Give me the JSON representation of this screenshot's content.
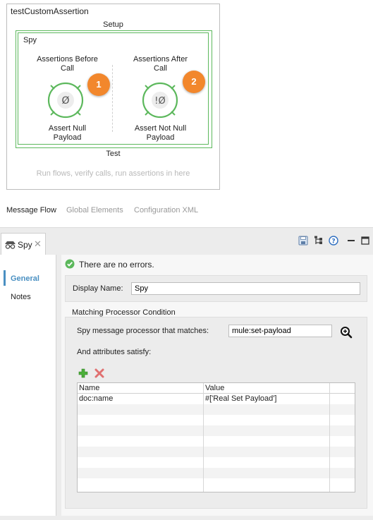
{
  "flow": {
    "title": "testCustomAssertion",
    "setup_label": "Setup",
    "spy_label": "Spy",
    "processors": [
      {
        "title": "Assertions Before Call",
        "title_line1": "Assertions Before",
        "title_line2": "Call",
        "badge": "1",
        "name_line1": "Assert Null",
        "name_line2": "Payload",
        "symbol": "Ø"
      },
      {
        "title": "Assertions After Call",
        "title_line1": "Assertions After",
        "title_line2": "Call",
        "badge": "2",
        "name_line1": "Assert Not Null",
        "name_line2": "Payload",
        "symbol": "!Ø"
      }
    ],
    "test_label": "Test",
    "run_hint": "Run flows, verify calls, run assertions in here",
    "accent_green": "#5cb85c",
    "badge_orange": "#f2872c"
  },
  "editor_tabs": [
    {
      "label": "Message Flow",
      "active": true
    },
    {
      "label": "Global Elements",
      "active": false
    },
    {
      "label": "Configuration XML",
      "active": false
    }
  ],
  "panel": {
    "tab_label": "Spy",
    "tab_icon": "spy-icon",
    "header_icons": [
      "save-icon",
      "tree-icon",
      "help-icon",
      "minimize-icon",
      "maximize-icon"
    ],
    "nav": [
      {
        "label": "General",
        "active": true
      },
      {
        "label": "Notes",
        "active": false
      }
    ],
    "status": "There are no errors.",
    "display_name_label": "Display Name:",
    "display_name_value": "Spy",
    "condition_title": "Matching Processor Condition",
    "matches_label": "Spy message processor that matches:",
    "matches_value": "mule:set-payload",
    "attributes_label": "And attributes satisfy:",
    "table": {
      "columns": [
        "Name",
        "Value"
      ],
      "rows": [
        {
          "name": "doc:name",
          "value": "#['Real Set Payload']"
        }
      ]
    },
    "accent_blue": "#4a90c2"
  }
}
